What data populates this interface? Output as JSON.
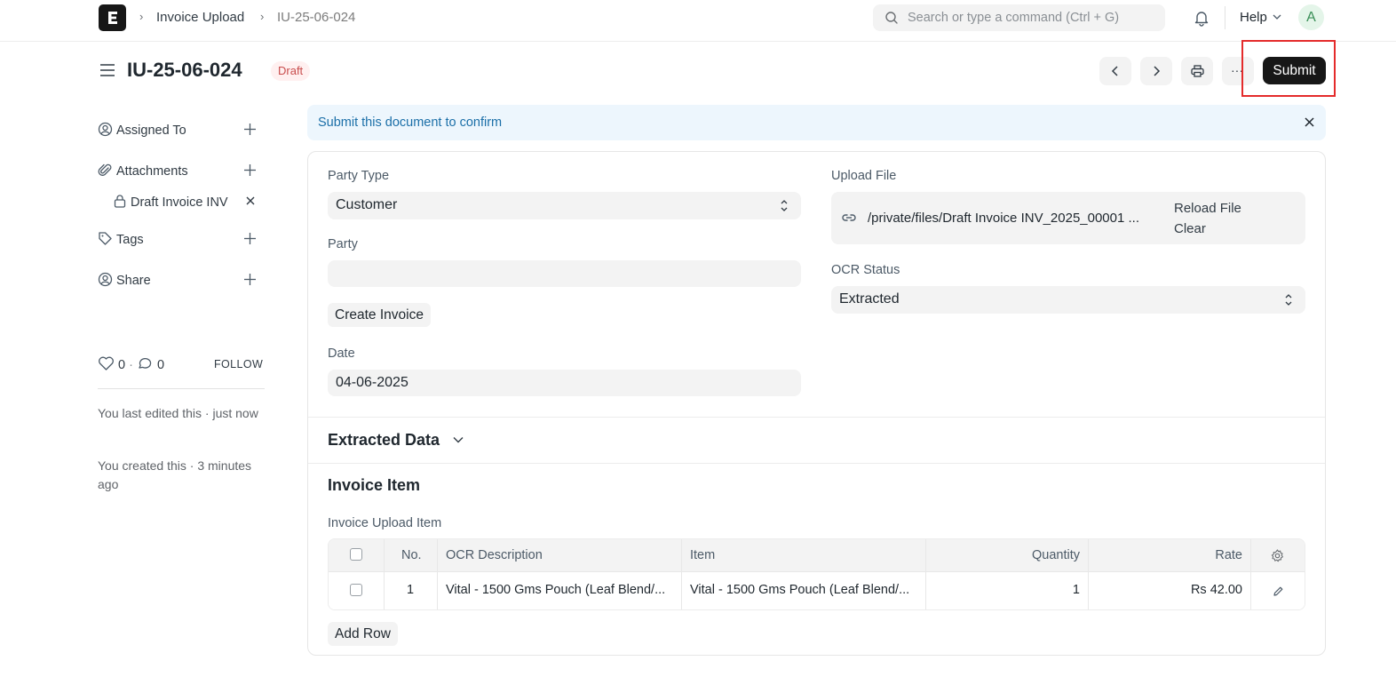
{
  "navbar": {
    "logo_letter": "E",
    "breadcrumb_sep": "›",
    "breadcrumbs": [
      "Invoice Upload",
      "IU-25-06-024"
    ],
    "search_placeholder": "Search or type a command (Ctrl + G)",
    "help_label": "Help",
    "avatar_initial": "A"
  },
  "page": {
    "title": "IU-25-06-024",
    "status": "Draft",
    "submit_label": "Submit",
    "more_label": "···"
  },
  "sidebar": {
    "assigned_to": "Assigned To",
    "attachments": "Attachments",
    "attachment_file": "Draft Invoice INV",
    "tags": "Tags",
    "share": "Share",
    "likes": "0",
    "dot": "·",
    "comments": "0",
    "follow": "FOLLOW",
    "activity": [
      "You last edited this · just now",
      "You created this · 3 minutes ago"
    ]
  },
  "alert": {
    "text": "Submit this document to confirm"
  },
  "form": {
    "party_type_label": "Party Type",
    "party_type_value": "Customer",
    "party_label": "Party",
    "party_value": "",
    "create_invoice_label": "Create Invoice",
    "date_label": "Date",
    "date_value": "04-06-2025",
    "upload_file_label": "Upload File",
    "upload_file_path": "/private/files/Draft Invoice INV_2025_00001 ...",
    "reload_file_label": "Reload File",
    "clear_label": "Clear",
    "ocr_status_label": "OCR Status",
    "ocr_status_value": "Extracted"
  },
  "sections": {
    "extracted_data": "Extracted Data",
    "invoice_item": "Invoice Item",
    "grid_label": "Invoice Upload Item"
  },
  "grid": {
    "columns": [
      "No.",
      "OCR Description",
      "Item",
      "Quantity",
      "Rate"
    ],
    "rows": [
      {
        "no": "1",
        "ocr_description": "Vital - 1500 Gms Pouch (Leaf Blend/...",
        "item": "Vital - 1500 Gms Pouch (Leaf Blend/...",
        "quantity": "1",
        "rate": "Rs 42.00"
      }
    ],
    "add_row_label": "Add Row"
  },
  "colors": {
    "accent_dark": "#171717",
    "highlight_red": "#e42b2b",
    "alert_bg": "#edf6fd",
    "draft_red": "#c94d4d"
  }
}
